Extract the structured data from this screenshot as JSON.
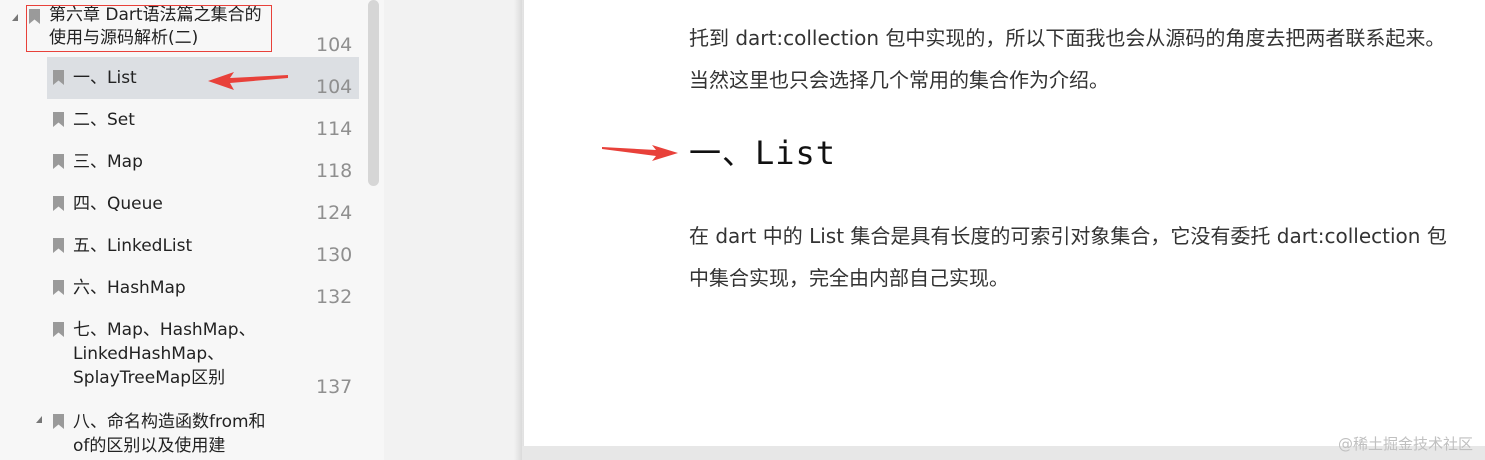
{
  "sidebar": {
    "chapter": {
      "title": "第六章 Dart语法篇之集合的使用与源码解析(二)",
      "page": "104"
    },
    "items": [
      {
        "label": "一、List",
        "page": "104",
        "selected": true
      },
      {
        "label": "二、Set",
        "page": "114"
      },
      {
        "label": "三、Map",
        "page": "118"
      },
      {
        "label": "四、Queue",
        "page": "124"
      },
      {
        "label": "五、LinkedList",
        "page": "130"
      },
      {
        "label": "六、HashMap",
        "page": "132"
      },
      {
        "label": "七、Map、HashMap、LinkedHashMap、SplayTreeMap区别",
        "page": "137"
      },
      {
        "label": "八、命名构造函数from和of的区别以及使用建",
        "page": ""
      }
    ]
  },
  "document": {
    "intro_paragraph": "托到 dart:collection 包中实现的，所以下面我也会从源码的角度去把两者联系起来。当然这里也只会选择几个常用的集合作为介绍。",
    "heading": "一、List",
    "body_paragraph": "在 dart 中的 List 集合是具有长度的可索引对象集合，它没有委托 dart:collection 包中集合实现，完全由内部自己实现。"
  },
  "watermark": "@稀土掘金技术社区",
  "colors": {
    "annotation_red": "#e8413a",
    "selected_bg": "#dcdfe3",
    "sidebar_bg": "#f7f7f7"
  },
  "icons": [
    "bookmark-icon",
    "collapse-triangle-icon",
    "red-arrow-annotation"
  ]
}
